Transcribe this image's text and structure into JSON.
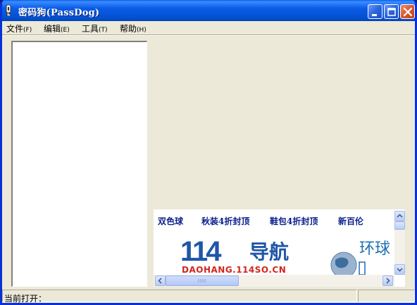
{
  "window": {
    "title": "密码狗(PassDog)"
  },
  "menu": [
    {
      "label": "文件",
      "hotkey": "(F)"
    },
    {
      "label": "编辑",
      "hotkey": "(E)"
    },
    {
      "label": "工具",
      "hotkey": "(T)"
    },
    {
      "label": "帮助",
      "hotkey": "(H)"
    }
  ],
  "ad": {
    "links": [
      "双色球",
      "秋装4折封顶",
      "鞋包4折封顶",
      "新百伦"
    ],
    "logo_number": "114",
    "logo_text": "导航",
    "logo_domain": "DAOHANG.114SO.CN",
    "partner_text": "环球"
  },
  "status": {
    "label": "当前打开："
  },
  "colors": {
    "titlebar": "#0a5be6",
    "window_bg": "#ece9d8",
    "link": "#0a1f8c",
    "logo_blue": "#1f56a8",
    "logo_red": "#d0261e"
  }
}
